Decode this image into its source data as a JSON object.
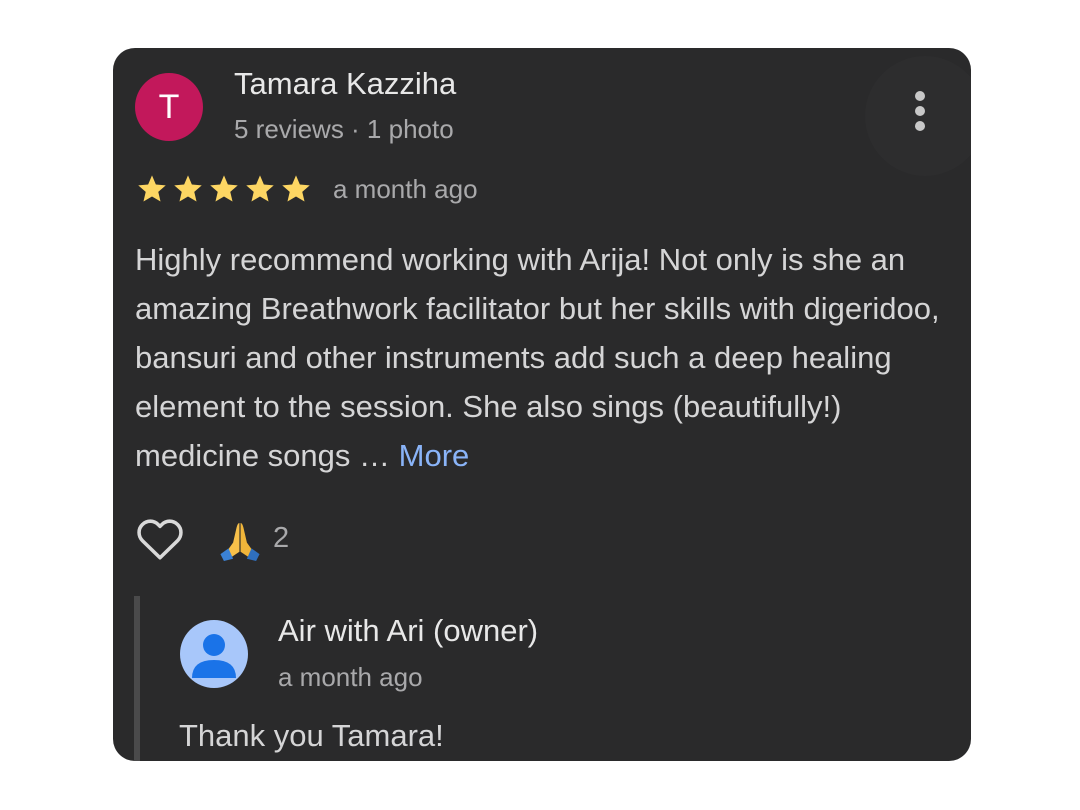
{
  "review": {
    "avatar_initial": "T",
    "avatar_color": "#c2185b",
    "reviewer_name": "Tamara Kazziha",
    "reviewer_meta": "5 reviews · 1 photo",
    "rating": 5,
    "rating_max": 5,
    "star_color": "#fdd663",
    "time": "a month ago",
    "text": "Highly recommend working with Arija! Not only is she an amazing Breathwork facilitator but her skills with digeridoo, bansuri and other instruments add such a deep healing element to the session. She also sings (beautifully!) medicine songs …",
    "more_label": "More",
    "link_color": "#8ab4f8",
    "menu_icon": "more-vert-icon"
  },
  "reactions": {
    "like_icon": "heart-outline-icon",
    "items": [
      {
        "emoji": "🙏",
        "icon": "folded-hands-icon",
        "count": "2"
      }
    ]
  },
  "owner_reply": {
    "avatar_icon": "person-icon",
    "avatar_color": "#a8c7fa",
    "name": "Air with Ari (owner)",
    "time": "a month ago",
    "text": "Thank you Tamara!"
  }
}
